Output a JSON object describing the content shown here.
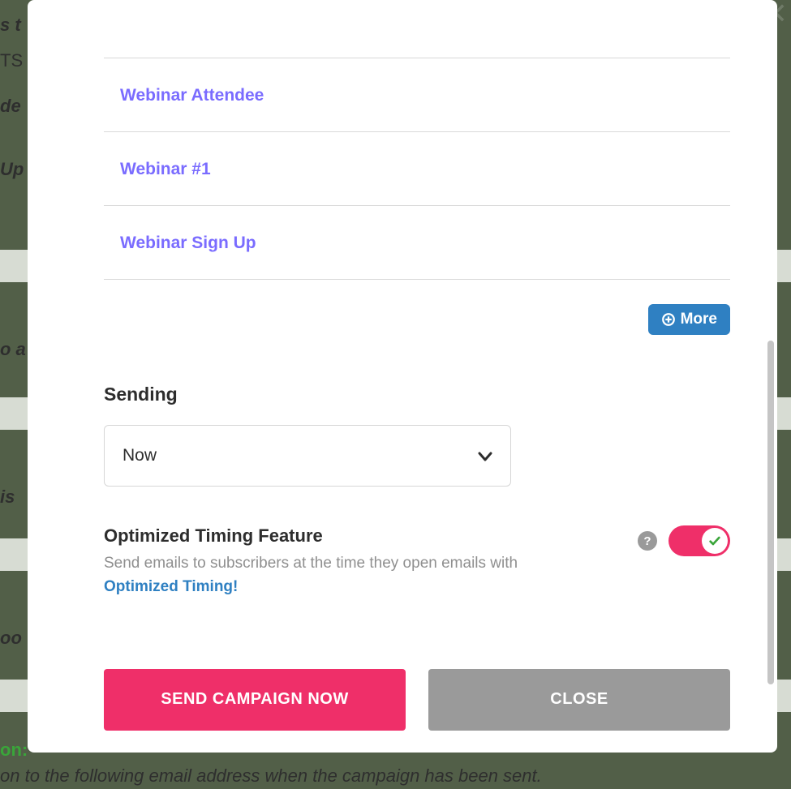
{
  "background": {
    "fragments": {
      "f1": "s t",
      "f2": "TS",
      "f3": "de",
      "f4": "Up",
      "f5": "o a",
      "f6": "is",
      "f7": "oo",
      "f8": "on:",
      "f9": "on to the following email address when the campaign has been sent."
    }
  },
  "lists": {
    "items": [
      {
        "label": "Webinar Attendee"
      },
      {
        "label": "Webinar #1"
      },
      {
        "label": "Webinar Sign Up"
      }
    ]
  },
  "more_button": {
    "label": "More"
  },
  "sending": {
    "title": "Sending",
    "selected": "Now"
  },
  "optimized_timing": {
    "title": "Optimized Timing Feature",
    "desc_prefix": "Send emails to subscribers at the time they open emails with ",
    "desc_link": "Optimized Timing!",
    "enabled": true
  },
  "actions": {
    "primary": "SEND CAMPAIGN NOW",
    "secondary": "CLOSE"
  },
  "colors": {
    "accent_pink": "#ef2f69",
    "accent_blue": "#2f80c2",
    "link_violet": "#7a6cff"
  }
}
